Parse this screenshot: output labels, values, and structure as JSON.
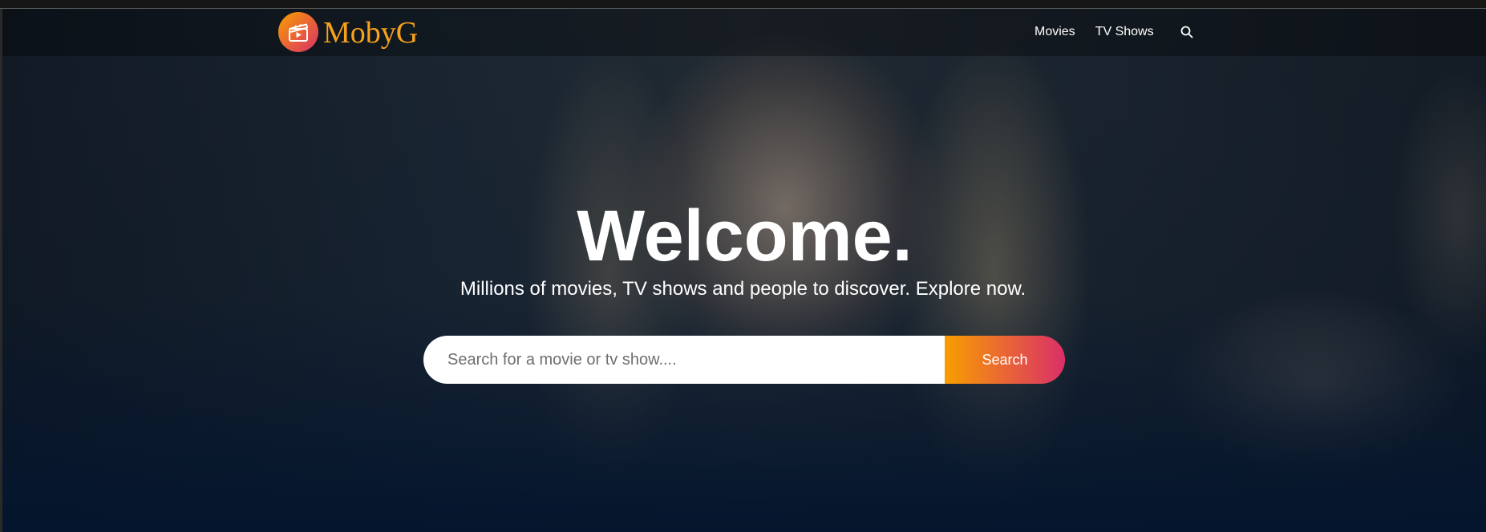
{
  "brand": {
    "name": "MobyG",
    "logo_icon": "clapperboard-play-icon"
  },
  "nav": {
    "items": [
      {
        "label": "Movies"
      },
      {
        "label": "TV Shows"
      }
    ],
    "search_icon": "search-icon"
  },
  "hero": {
    "title": "Welcome.",
    "subtitle": "Millions of movies, TV shows and people to discover. Explore now.",
    "search": {
      "placeholder": "Search for a movie or tv show....",
      "value": "",
      "button_label": "Search"
    }
  },
  "colors": {
    "accent_orange": "#f89e00",
    "accent_pink": "#da2f68",
    "logo_text": "#f7a21c",
    "background": "#04152d"
  }
}
